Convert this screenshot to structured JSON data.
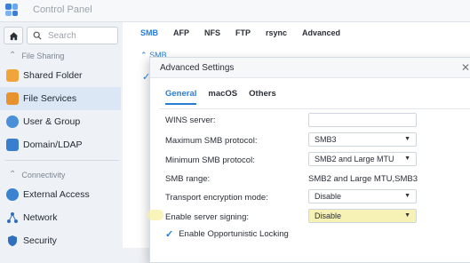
{
  "window": {
    "title": "Control Panel"
  },
  "sidebar": {
    "search_placeholder": "Search",
    "groups": [
      {
        "label": "File Sharing"
      },
      {
        "label": "Connectivity"
      }
    ],
    "items": [
      {
        "label": "Shared Folder"
      },
      {
        "label": "File Services"
      },
      {
        "label": "User & Group"
      },
      {
        "label": "Domain/LDAP"
      },
      {
        "label": "External Access"
      },
      {
        "label": "Network"
      },
      {
        "label": "Security"
      }
    ],
    "colors": {
      "active_bg": "#dbe7f5"
    }
  },
  "main": {
    "tabs": [
      {
        "label": "SMB"
      },
      {
        "label": "AFP"
      },
      {
        "label": "NFS"
      },
      {
        "label": "FTP"
      },
      {
        "label": "rsync"
      },
      {
        "label": "Advanced"
      }
    ],
    "section_label": "SMB"
  },
  "dialog": {
    "title": "Advanced Settings",
    "tabs": [
      {
        "label": "General"
      },
      {
        "label": "macOS"
      },
      {
        "label": "Others"
      }
    ],
    "fields": {
      "wins": {
        "label": "WINS server:",
        "value": ""
      },
      "max_smb": {
        "label": "Maximum SMB protocol:",
        "value": "SMB3"
      },
      "min_smb": {
        "label": "Minimum SMB protocol:",
        "value": "SMB2 and Large MTU"
      },
      "smb_range": {
        "label": "SMB range:",
        "value": "SMB2 and Large MTU,SMB3"
      },
      "transport": {
        "label": "Transport encryption mode:",
        "value": "Disable"
      },
      "signing": {
        "label": "Enable server signing:",
        "value": "Disable"
      }
    },
    "oplock": {
      "label": "Enable Opportunistic Locking",
      "checked": true
    }
  },
  "colors": {
    "accent": "#2a7bd4",
    "highlight": "#f6f1b4"
  }
}
